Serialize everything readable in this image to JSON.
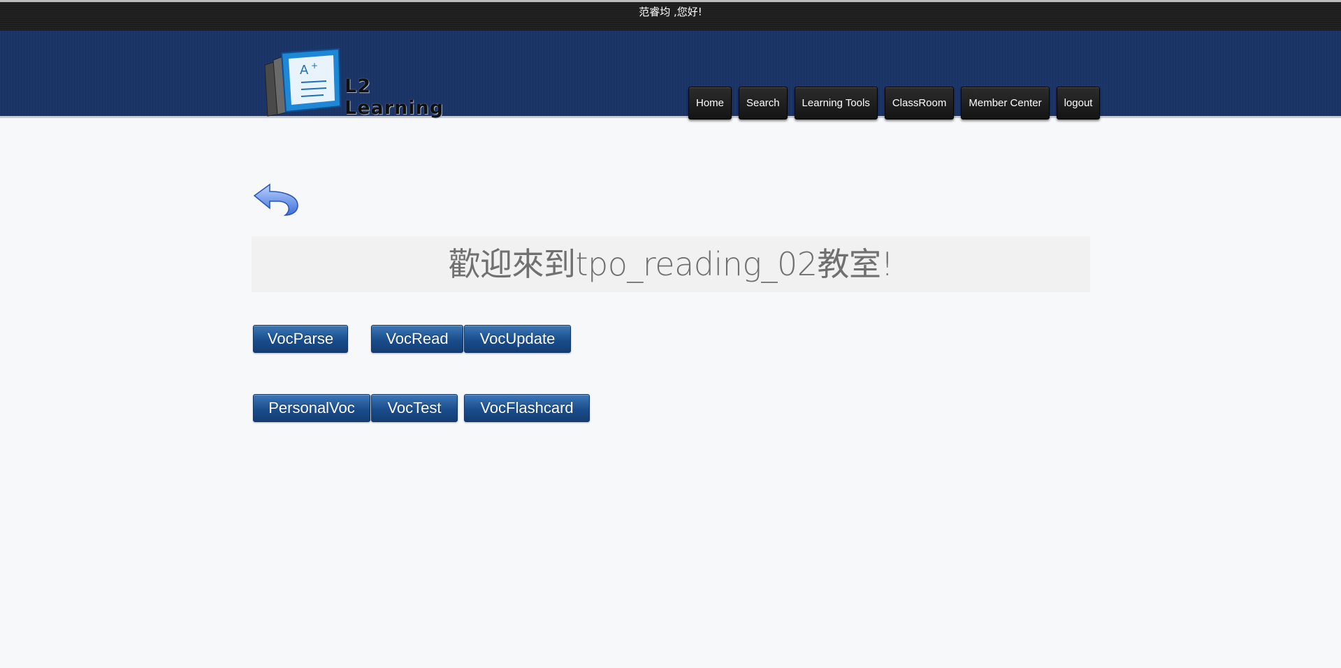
{
  "greeting": "范睿均 ,您好!",
  "logo": {
    "text": "L2 Learning"
  },
  "nav": {
    "home": "Home",
    "search": "Search",
    "learning_tools": "Learning Tools",
    "classroom": "ClassRoom",
    "member_center": "Member Center",
    "logout": "logout"
  },
  "welcome_text": "歡迎來到tpo_reading_02教室!",
  "tools": {
    "voc_parse": "VocParse",
    "voc_read": "VocRead",
    "voc_update": "VocUpdate",
    "personal_voc": "PersonalVoc",
    "voc_test": "VocTest",
    "voc_flashcard": "VocFlashcard"
  },
  "colors": {
    "header_bg": "#1b3467",
    "greeting_bar_bg": "#1e1e1e",
    "button_blue": "#1a4d8c",
    "nav_button_bg": "#1f1f1f"
  }
}
